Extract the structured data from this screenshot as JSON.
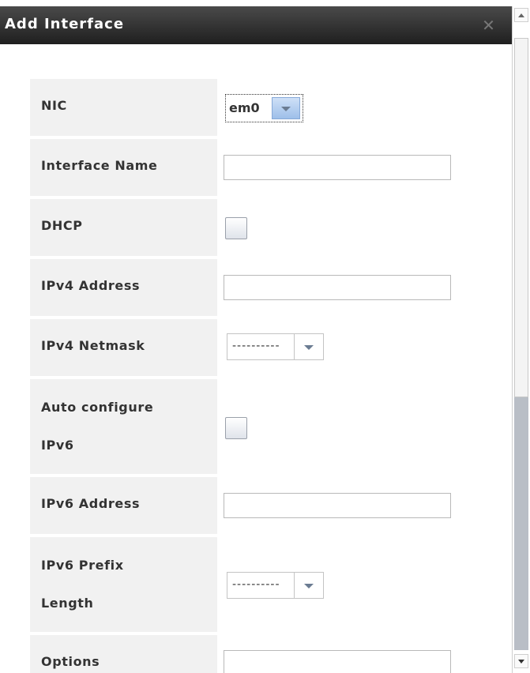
{
  "dialog": {
    "title": "Add Interface",
    "close_icon": "close-icon"
  },
  "fields": {
    "nic": {
      "label": "NIC",
      "value": "em0"
    },
    "interface_name": {
      "label": "Interface Name",
      "value": ""
    },
    "dhcp": {
      "label": "DHCP",
      "checked": false
    },
    "ipv4_address": {
      "label": "IPv4 Address",
      "value": ""
    },
    "ipv4_netmask": {
      "label": "IPv4 Netmask",
      "value": "----------"
    },
    "auto_configure_ipv6": {
      "label_line1": "Auto configure",
      "label_line2": "IPv6",
      "checked": false
    },
    "ipv6_address": {
      "label": "IPv6 Address",
      "value": ""
    },
    "ipv6_prefix_length": {
      "label_line1": "IPv6 Prefix",
      "label_line2": "Length",
      "value": "----------"
    },
    "options": {
      "label": "Options",
      "value": ""
    }
  },
  "colors": {
    "titlebar": "#2b2b2b",
    "label_background": "#f1f1f1",
    "dropdown_accent": "#9dbfe9"
  }
}
